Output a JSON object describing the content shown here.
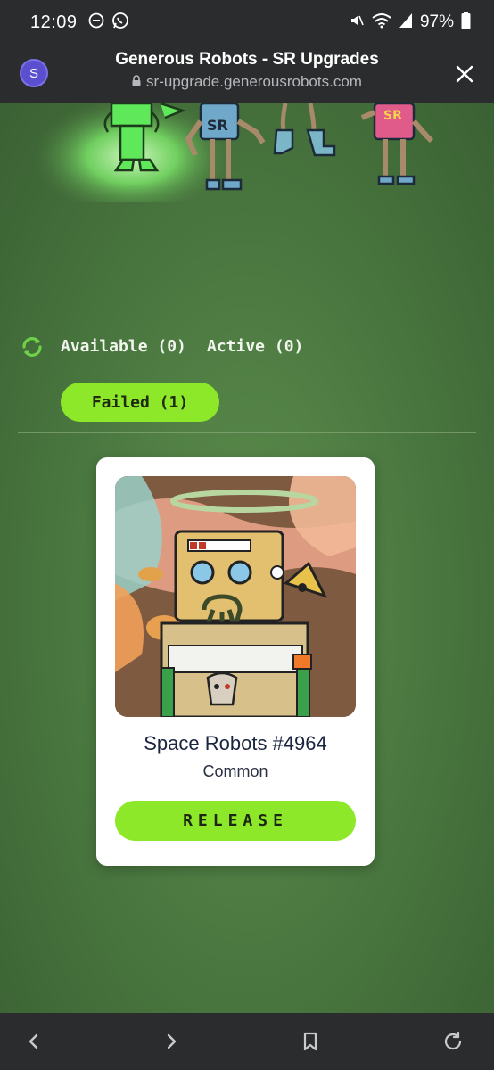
{
  "status_bar": {
    "time": "12:09",
    "battery": "97%",
    "icons": [
      "do-not-disturb-icon",
      "whatsapp-icon",
      "mute-icon",
      "wifi-icon",
      "signal-icon",
      "battery-icon"
    ]
  },
  "browser": {
    "site_initial": "S",
    "title": "Generous Robots - SR Upgrades",
    "url": "sr-upgrade.generousrobots.com"
  },
  "tabs": {
    "available": "Available (0)",
    "active": "Active (0)",
    "failed": "Failed (1)",
    "selected": "failed"
  },
  "card": {
    "name": "Space Robots #4964",
    "rarity": "Common",
    "button": "RELEASE"
  },
  "colors": {
    "accent": "#8ee82a",
    "chrome": "#2a2c2e",
    "page_bg": "#4c7a41"
  }
}
